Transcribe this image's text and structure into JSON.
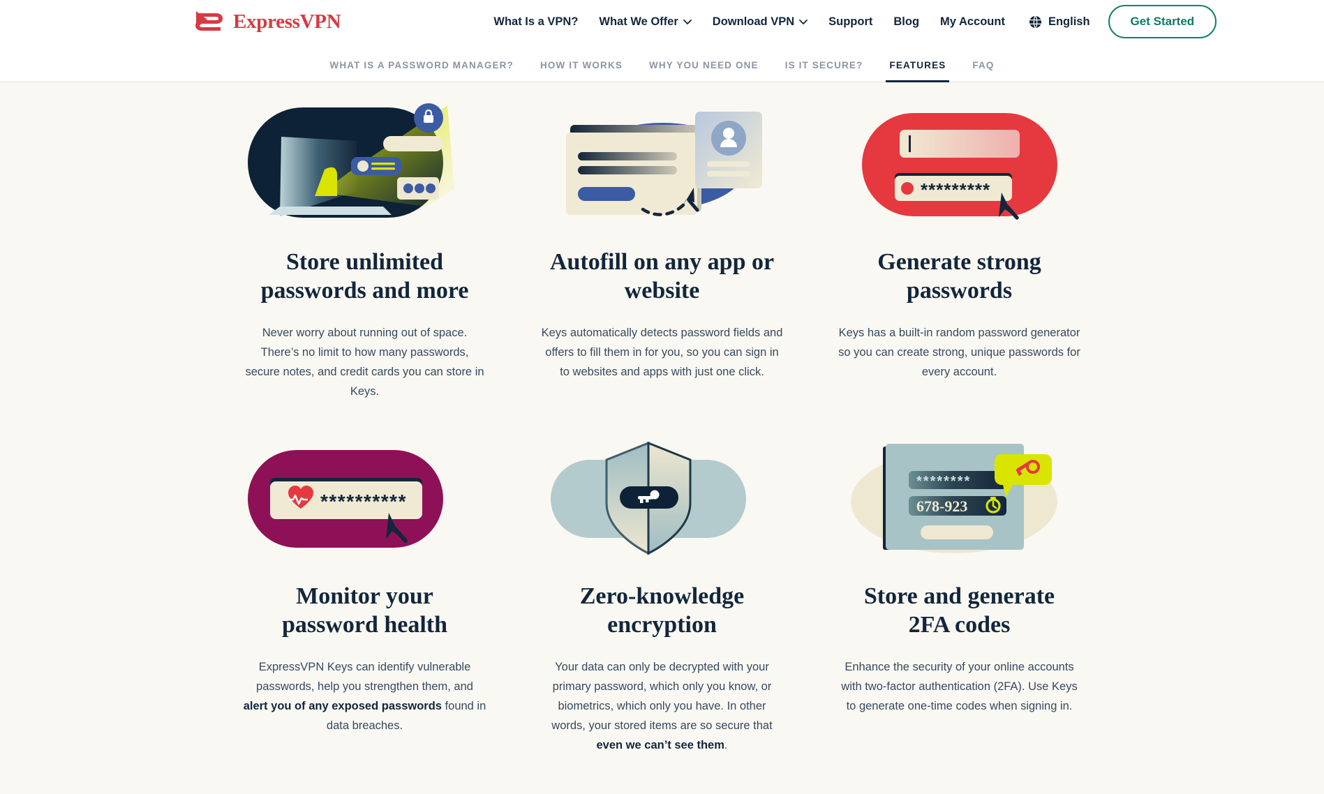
{
  "header": {
    "brand": "ExpressVPN",
    "logo_icon": "expressvpn-logo-icon",
    "nav": [
      {
        "label": "What Is a VPN?",
        "has_caret": false,
        "name": "what-is-a-vpn"
      },
      {
        "label": "What We Offer",
        "has_caret": true,
        "name": "what-we-offer"
      },
      {
        "label": "Download VPN",
        "has_caret": true,
        "name": "download-vpn"
      },
      {
        "label": "Support",
        "has_caret": false,
        "name": "support"
      },
      {
        "label": "Blog",
        "has_caret": false,
        "name": "blog"
      },
      {
        "label": "My Account",
        "has_caret": false,
        "name": "my-account"
      }
    ],
    "language": "English",
    "language_icon": "globe-icon",
    "cta_label": "Get Started",
    "cta_color": "#0d7a63"
  },
  "subnav": {
    "items": [
      {
        "label": "WHAT IS A PASSWORD MANAGER?",
        "active": false
      },
      {
        "label": "HOW IT WORKS",
        "active": false
      },
      {
        "label": "WHY YOU NEED ONE",
        "active": false
      },
      {
        "label": "IS IT SECURE?",
        "active": false
      },
      {
        "label": "FEATURES",
        "active": true
      },
      {
        "label": "FAQ",
        "active": false
      }
    ]
  },
  "features": [
    {
      "title": "Store unlimited passwords and more",
      "body": "Never worry about running out of space. There’s no limit to how many passwords, secure notes, and credit cards you can store in Keys.",
      "body_bold": "",
      "body_tail": "",
      "art": "laptop-spotlight-lock-illustration",
      "art_bg": "#0d2236"
    },
    {
      "title": "Autofill on any app or website",
      "body": "Keys automatically detects password fields and offers to fill them in for you, so you can sign in to websites and apps with just one click.",
      "body_bold": "",
      "body_tail": "",
      "art": "autofill-form-profile-card-illustration",
      "art_bg": "#3b5ba3"
    },
    {
      "title": "Generate strong passwords",
      "body": "Keys has a built-in random password generator so you can create strong, unique passwords for every account.",
      "body_bold": "",
      "body_tail": "",
      "art": "password-generator-illustration",
      "art_bg": "#e5393f"
    },
    {
      "title": "Monitor your password health",
      "body": "ExpressVPN Keys can identify vulnerable passwords, help you strengthen them, and ",
      "body_bold": "alert you of any exposed passwords",
      "body_tail": " found in data breaches.",
      "art": "password-health-heartbeat-illustration",
      "art_bg": "#8e1157"
    },
    {
      "title": "Zero-knowledge encryption",
      "body": "Your data can only be decrypted with your primary password, which only you know, or biometrics, which only you have. In other words, your stored items are so secure that ",
      "body_bold": "even we can’t see them",
      "body_tail": ".",
      "art": "shield-key-illustration",
      "art_bg": "#b4cbcd"
    },
    {
      "title": "Store and generate 2FA codes",
      "body": "Enhance the security of your online accounts with two-factor authentication (2FA). Use Keys to generate one-time codes when signing in.",
      "body_bold": "",
      "body_tail": "",
      "art": "twofa-code-illustration",
      "art_bg": "#a8c3c6",
      "code_value": "678-923",
      "masked_value": "********"
    }
  ],
  "page": {
    "background": "#faf8f2"
  }
}
